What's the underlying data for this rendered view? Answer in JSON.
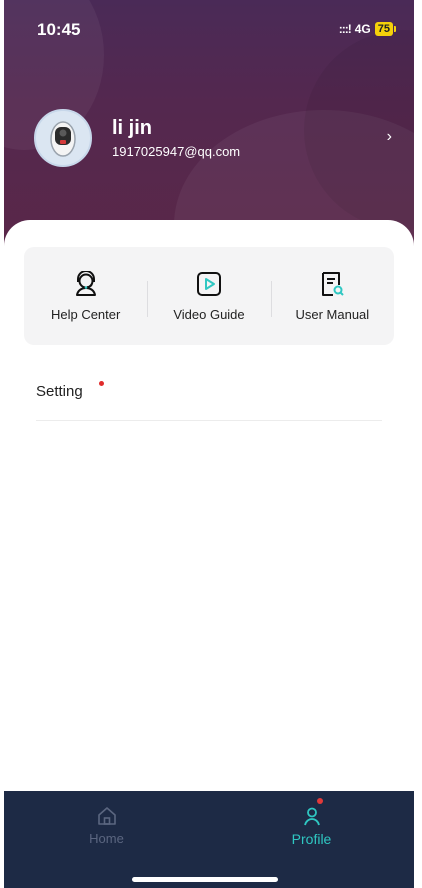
{
  "status": {
    "time": "10:45",
    "signal": ":::!",
    "network": "4G",
    "battery": "75"
  },
  "profile": {
    "name": "li jin",
    "email": "1917025947@qq.com",
    "chevron": "›"
  },
  "tools": [
    {
      "label": "Help Center",
      "icon": "headset-icon"
    },
    {
      "label": "Video Guide",
      "icon": "play-icon"
    },
    {
      "label": "User Manual",
      "icon": "document-search-icon"
    }
  ],
  "settings": {
    "label": "Setting"
  },
  "tabs": [
    {
      "label": "Home",
      "icon": "home-icon"
    },
    {
      "label": "Profile",
      "icon": "profile-icon"
    }
  ],
  "colors": {
    "header": "#4a2a57",
    "tabbar": "#1d2a45",
    "accent": "#2fc7c2",
    "dot": "#e02b2b"
  }
}
